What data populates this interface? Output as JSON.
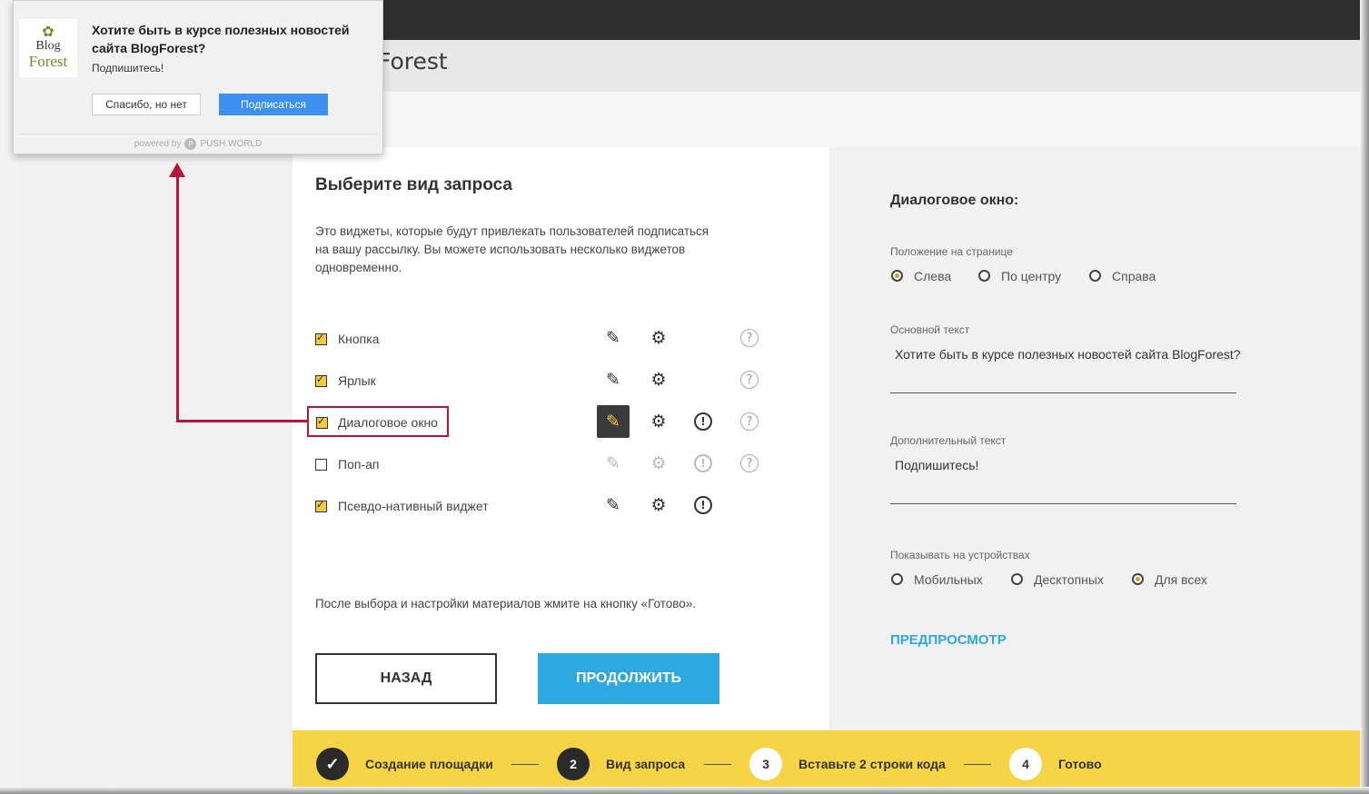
{
  "header": {
    "title_fragment": "Forest"
  },
  "popup": {
    "logo_line1": "Blog",
    "logo_line2": "Forest",
    "title": "Хотите быть в курсе полезных новостей сайта BlogForest?",
    "subtitle": "Подпишитесь!",
    "decline_label": "Спасибо, но нет",
    "accept_label": "Подписаться",
    "footer_powered": "powered by",
    "footer_brand": "PUSH.WORLD"
  },
  "left_panel": {
    "title": "Выберите вид запроса",
    "description": "Это виджеты, которые будут привлекать пользователей подписаться на вашу рассылку. Вы можете использовать несколько виджетов одновременно.",
    "widgets": [
      {
        "label": "Кнопка",
        "checked": true
      },
      {
        "label": "Ярлык",
        "checked": true
      },
      {
        "label": "Диалоговое окно",
        "checked": true
      },
      {
        "label": "Поп-ап",
        "checked": false
      },
      {
        "label": "Псевдо-нативный виджет",
        "checked": true
      }
    ],
    "note": "После выбора и настройки материалов жмите на кнопку «Готово».",
    "back_label": "НАЗАД",
    "continue_label": "ПРОДОЛЖИТЬ"
  },
  "right_panel": {
    "title": "Диалоговое окно:",
    "position_label": "Положение на странице",
    "position_options": [
      "Слева",
      "По центру",
      "Справа"
    ],
    "position_selected": "Слева",
    "main_text_label": "Основной текст",
    "main_text_value": "Хотите быть в курсе полезных новостей сайта BlogForest?",
    "extra_text_label": "Дополнительный текст",
    "extra_text_value": "Подпишитесь!",
    "devices_label": "Показывать на устройствах",
    "devices_options": [
      "Мобильных",
      "Десктопных",
      "Для всех"
    ],
    "devices_selected": "Для всех",
    "preview_label": "ПРЕДПРОСМОТР"
  },
  "steps": [
    {
      "number": "✓",
      "label": "Создание площадки",
      "state": "done"
    },
    {
      "number": "2",
      "label": "Вид запроса",
      "state": "current"
    },
    {
      "number": "3",
      "label": "Вставьте 2 строки кода",
      "state": "pending"
    },
    {
      "number": "4",
      "label": "Готово",
      "state": "pending"
    }
  ],
  "icons": {
    "edit": "pencil-icon",
    "settings": "gear-eye-icon",
    "schedule": "clock-alert-icon",
    "help": "question-icon"
  },
  "colors": {
    "accent_yellow": "#f5d547",
    "accent_blue": "#2ea9e0",
    "annotation_red": "#b5173e",
    "popup_blue": "#3d8ff0"
  }
}
